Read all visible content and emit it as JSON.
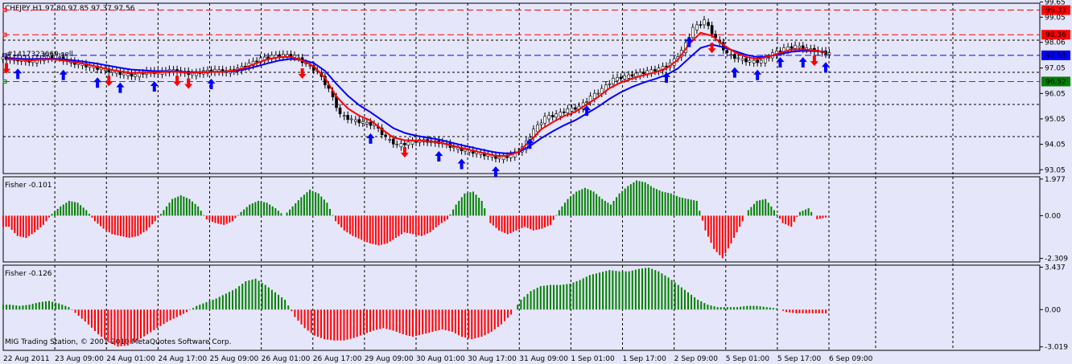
{
  "chart_data": [
    {
      "type": "candlestick",
      "title": "CHFJPY,H1  97.80 97.85 97.37 97.56",
      "ylim": [
        92.9,
        99.6
      ],
      "y_ticks": [
        "99.65",
        "99.05",
        "98.06",
        "97.05",
        "96.05",
        "95.05",
        "94.05",
        "93.05"
      ],
      "y_tick_values": [
        99.65,
        99.05,
        98.06,
        97.05,
        96.05,
        95.05,
        94.05,
        93.05
      ],
      "levels": [
        {
          "label": "99.33",
          "value": 99.33,
          "color": "#ff0000",
          "style": "dashed"
        },
        {
          "label": "98.36",
          "value": 98.36,
          "color": "#ff0000",
          "style": "dashed"
        },
        {
          "label": "97.55",
          "value": 97.55,
          "color": "#0000ff",
          "style": "dashed"
        },
        {
          "label": "96.52",
          "value": 96.52,
          "color": "#008000",
          "style": "dashed"
        }
      ],
      "order_label": "#1417323669 sell",
      "close": [
        97.4,
        97.35,
        97.3,
        97.45,
        97.5,
        97.3,
        97.2,
        97.1,
        97.0,
        96.9,
        96.8,
        96.75,
        96.9,
        96.85,
        96.95,
        96.9,
        96.8,
        96.9,
        96.95,
        96.9,
        97.0,
        97.2,
        97.4,
        97.5,
        97.55,
        97.5,
        97.2,
        96.9,
        96.2,
        95.2,
        95.0,
        94.9,
        94.8,
        94.3,
        94.0,
        94.1,
        94.2,
        94.15,
        94.1,
        93.9,
        93.8,
        93.7,
        93.6,
        93.5,
        93.6,
        93.9,
        94.6,
        95.1,
        95.2,
        95.4,
        95.5,
        95.9,
        96.2,
        96.6,
        96.7,
        96.8,
        96.9,
        97.0,
        97.2,
        97.7,
        98.6,
        98.9,
        98.2,
        97.6,
        97.4,
        97.3,
        97.3,
        97.6,
        97.8,
        97.9,
        97.8,
        97.7,
        97.6
      ],
      "ma_red": [
        97.4,
        97.38,
        97.35,
        97.38,
        97.4,
        97.35,
        97.28,
        97.2,
        97.1,
        97.0,
        96.92,
        96.86,
        96.87,
        96.87,
        96.9,
        96.9,
        96.86,
        96.88,
        96.9,
        96.9,
        96.95,
        97.07,
        97.25,
        97.4,
        97.48,
        97.49,
        97.35,
        97.12,
        96.66,
        95.93,
        95.46,
        95.18,
        94.99,
        94.64,
        94.32,
        94.21,
        94.2,
        94.17,
        94.13,
        94.02,
        93.91,
        93.8,
        93.7,
        93.6,
        93.6,
        93.75,
        94.18,
        94.64,
        94.92,
        95.16,
        95.33,
        95.62,
        95.91,
        96.26,
        96.48,
        96.64,
        96.77,
        96.88,
        97.04,
        97.37,
        97.99,
        98.44,
        98.32,
        97.96,
        97.68,
        97.49,
        97.4,
        97.5,
        97.65,
        97.78,
        97.79,
        97.74,
        97.67
      ],
      "ma_blue": [
        97.45,
        97.42,
        97.4,
        97.41,
        97.42,
        97.39,
        97.35,
        97.29,
        97.22,
        97.14,
        97.06,
        96.99,
        96.96,
        96.93,
        96.93,
        96.92,
        96.89,
        96.89,
        96.9,
        96.9,
        96.93,
        97.0,
        97.12,
        97.24,
        97.35,
        97.41,
        97.37,
        97.25,
        96.94,
        96.43,
        95.96,
        95.59,
        95.31,
        95.0,
        94.69,
        94.5,
        94.39,
        94.31,
        94.24,
        94.13,
        94.02,
        93.92,
        93.82,
        93.73,
        93.69,
        93.74,
        93.98,
        94.29,
        94.56,
        94.8,
        95.0,
        95.26,
        95.53,
        95.84,
        96.1,
        96.31,
        96.48,
        96.62,
        96.78,
        97.03,
        97.44,
        97.84,
        97.97,
        97.87,
        97.72,
        97.57,
        97.48,
        97.51,
        97.6,
        97.69,
        97.73,
        97.72,
        97.69
      ],
      "buy_arrows": [
        1,
        5,
        8,
        10,
        13,
        18,
        32,
        38,
        40,
        43,
        46,
        51,
        58,
        60,
        64,
        66,
        68,
        70,
        72
      ],
      "sell_arrows": [
        0,
        9,
        15,
        16,
        26,
        35,
        62,
        71
      ]
    },
    {
      "type": "bar",
      "title": "Fisher -0.101",
      "y_ticks": [
        "1.977",
        "0.00",
        "-2.309"
      ],
      "y_tick_values": [
        1.977,
        0.0,
        -2.309
      ],
      "ylim": [
        -2.5,
        2.1
      ],
      "values": [
        -0.6,
        -1.1,
        -1.2,
        -0.9,
        -0.5,
        0.1,
        0.5,
        0.8,
        0.7,
        0.3,
        -0.3,
        -0.7,
        -1.0,
        -1.1,
        -1.2,
        -1.1,
        -0.8,
        -0.3,
        0.3,
        0.9,
        1.1,
        0.9,
        0.5,
        -0.2,
        -0.4,
        -0.5,
        -0.3,
        0.2,
        0.6,
        0.8,
        0.7,
        0.4,
        0.0,
        0.5,
        1.0,
        1.4,
        1.2,
        0.7,
        -0.3,
        -0.8,
        -1.1,
        -1.3,
        -1.5,
        -1.6,
        -1.5,
        -1.2,
        -0.9,
        -1.0,
        -1.1,
        -0.9,
        -0.5,
        -0.2,
        0.6,
        1.2,
        1.3,
        0.8,
        -0.4,
        -0.8,
        -1.0,
        -0.8,
        -0.6,
        -0.8,
        -0.7,
        -0.5,
        0.3,
        0.9,
        1.3,
        1.5,
        1.3,
        0.9,
        0.6,
        1.2,
        1.6,
        1.9,
        1.8,
        1.5,
        1.3,
        1.2,
        1.0,
        0.9,
        0.8,
        -0.8,
        -1.8,
        -2.3,
        -1.5,
        -0.6,
        0.3,
        0.8,
        0.9,
        0.3,
        -0.4,
        -0.6,
        0.2,
        0.4,
        -0.2,
        -0.1
      ]
    },
    {
      "type": "bar",
      "title": "Fisher -0.126",
      "y_ticks": [
        "3.437",
        "0.00",
        "-3.019"
      ],
      "y_tick_values": [
        3.437,
        0.0,
        -3.019
      ],
      "ylim": [
        -3.3,
        3.6
      ],
      "values": [
        0.4,
        0.3,
        0.4,
        0.6,
        0.7,
        0.5,
        0.2,
        -0.5,
        -1.2,
        -2.0,
        -2.6,
        -3.0,
        -2.9,
        -2.5,
        -2.0,
        -1.5,
        -1.0,
        -0.6,
        -0.2,
        0.3,
        0.6,
        0.9,
        1.3,
        1.7,
        2.3,
        2.5,
        2.0,
        1.4,
        0.8,
        -0.6,
        -1.5,
        -2.1,
        -2.4,
        -2.5,
        -2.5,
        -2.3,
        -2.0,
        -1.7,
        -1.5,
        -1.7,
        -2.0,
        -2.2,
        -2.0,
        -1.8,
        -1.6,
        -1.8,
        -2.2,
        -2.4,
        -2.2,
        -1.8,
        -1.2,
        -0.4,
        0.8,
        1.5,
        1.9,
        2.0,
        2.0,
        2.1,
        2.4,
        2.8,
        3.0,
        3.2,
        3.1,
        3.1,
        3.3,
        3.4,
        3.1,
        2.6,
        2.0,
        1.4,
        0.8,
        0.4,
        0.2,
        0.2,
        0.2,
        0.3,
        0.3,
        0.2,
        0.1,
        -0.2,
        -0.3,
        -0.3,
        -0.3,
        -0.3
      ]
    }
  ],
  "x_axis": {
    "labels": [
      "22 Aug 2011",
      "23 Aug 09:00",
      "24 Aug 01:00",
      "24 Aug 17:00",
      "25 Aug 09:00",
      "26 Aug 01:00",
      "26 Aug 17:00",
      "29 Aug 09:00",
      "30 Aug 01:00",
      "30 Aug 17:00",
      "31 Aug 09:00",
      "1 Sep 01:00",
      "1 Sep 17:00",
      "2 Sep 09:00",
      "5 Sep 01:00",
      "5 Sep 17:00",
      "6 Sep 09:00"
    ]
  },
  "copyright": "MIG Trading Station, © 2001-2010 MetaQuotes Software Corp.",
  "colors": {
    "background": "#e6e6fa",
    "grid": "#000000",
    "bull": "#008000",
    "bear": "#ff0000",
    "ma_red": "#ff0000",
    "ma_blue": "#0000ff",
    "price_label_bg": "#ff0000",
    "current_label_bg": "#0000ff",
    "support_label_bg": "#008000"
  }
}
